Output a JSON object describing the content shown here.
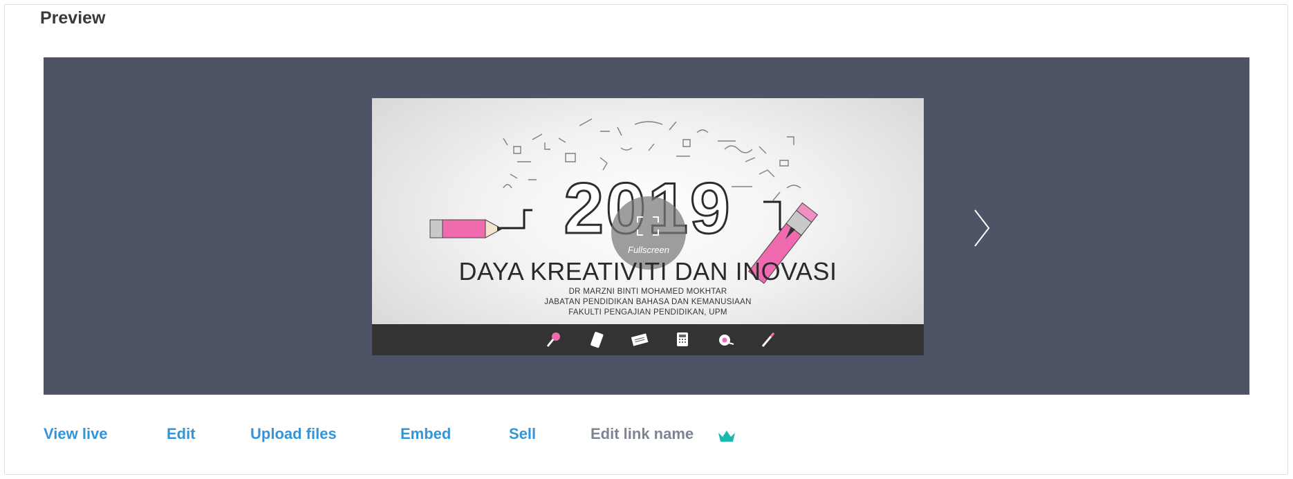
{
  "header": {
    "title": "Preview"
  },
  "slide": {
    "year": "2019",
    "fullscreen_label": "Fullscreen",
    "headline": "DAYA KREATIVITI DAN INOVASI",
    "subtitle_lines": [
      "DR MARZNI BINTI MOHAMED MOKHTAR",
      "JABATAN PENDIDIKAN BAHASA DAN KEMANUSIAAN",
      "FAKULTI PENGAJIAN PENDIDIKAN, UPM"
    ],
    "bottom_icons": [
      "magnifier-icon",
      "phone-icon",
      "keyboard-icon",
      "calculator-icon",
      "tape-icon",
      "pencil-icon"
    ],
    "colors": {
      "pencil_pink": "#f06ab0",
      "bar": "#333333",
      "stage": "#4e5465"
    }
  },
  "actions": {
    "view_live": "View live",
    "edit": "Edit",
    "upload_files": "Upload files",
    "embed": "Embed",
    "sell": "Sell",
    "edit_link_name": "Edit link name",
    "link_color": "#3494d8",
    "premium_icon": "crown-icon",
    "premium_color": "#1bb8b0"
  }
}
